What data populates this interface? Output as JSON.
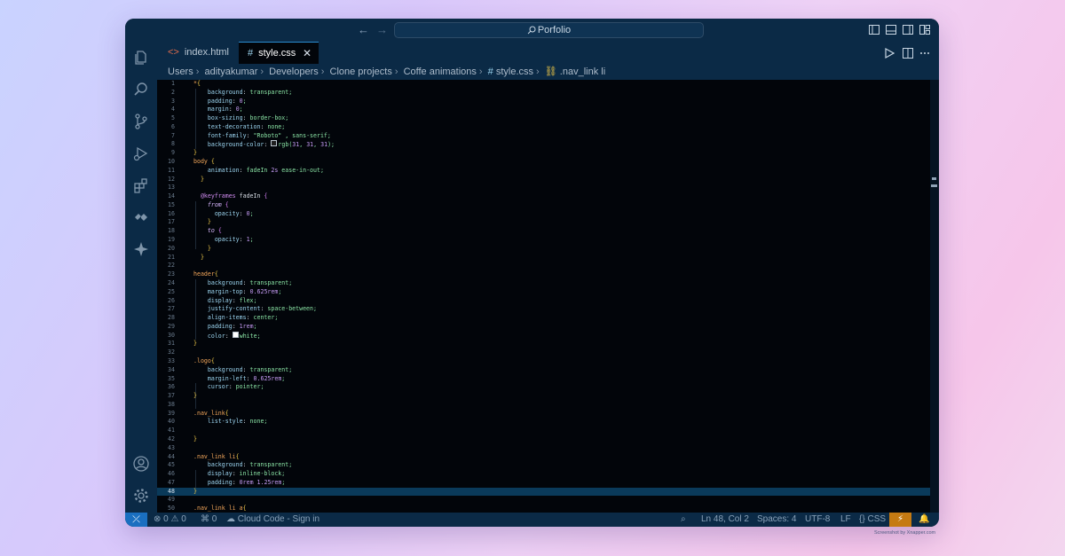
{
  "titlebar": {
    "search_label": "Porfolio"
  },
  "tabs": [
    {
      "label": "index.html",
      "icon": "html-file-icon",
      "active": false
    },
    {
      "label": "style.css",
      "icon": "css-file-icon",
      "active": true,
      "close": "✕"
    }
  ],
  "breadcrumb": [
    "Users",
    "adityakumar",
    "Developers",
    "Clone projects",
    "Coffe animations",
    "style.css",
    ".nav_link li"
  ],
  "editor": {
    "language": "CSS",
    "current_line": 48,
    "lines": [
      {
        "n": "1",
        "t": "*{"
      },
      {
        "n": "2",
        "t": "    background: transparent;"
      },
      {
        "n": "3",
        "t": "    padding: 0;"
      },
      {
        "n": "4",
        "t": "    margin: 0;"
      },
      {
        "n": "5",
        "t": "    box-sizing: border-box;"
      },
      {
        "n": "6",
        "t": "    text-decoration: none;"
      },
      {
        "n": "7",
        "t": "    font-family: \"Roboto\" , sans-serif;"
      },
      {
        "n": "8",
        "t": "    background-color: rgb(31, 31, 31);"
      },
      {
        "n": "9",
        "t": "}"
      },
      {
        "n": "10",
        "t": "body {"
      },
      {
        "n": "11",
        "t": "    animation: fadeIn 2s ease-in-out;"
      },
      {
        "n": "12",
        "t": "  }"
      },
      {
        "n": "13",
        "t": ""
      },
      {
        "n": "14",
        "t": "  @keyframes fadeIn {"
      },
      {
        "n": "15",
        "t": "    from {"
      },
      {
        "n": "16",
        "t": "      opacity: 0;"
      },
      {
        "n": "17",
        "t": "    }"
      },
      {
        "n": "18",
        "t": "    to {"
      },
      {
        "n": "19",
        "t": "      opacity: 1;"
      },
      {
        "n": "20",
        "t": "    }"
      },
      {
        "n": "21",
        "t": "  }"
      },
      {
        "n": "22",
        "t": ""
      },
      {
        "n": "23",
        "t": "header{"
      },
      {
        "n": "24",
        "t": "    background: transparent;"
      },
      {
        "n": "25",
        "t": "    margin-top: 0.625rem;"
      },
      {
        "n": "26",
        "t": "    display: flex;"
      },
      {
        "n": "27",
        "t": "    justify-content: space-between;"
      },
      {
        "n": "28",
        "t": "    align-items: center;"
      },
      {
        "n": "29",
        "t": "    padding: 1rem;"
      },
      {
        "n": "30",
        "t": "    color: white;"
      },
      {
        "n": "31",
        "t": "}"
      },
      {
        "n": "32",
        "t": ""
      },
      {
        "n": "33",
        "t": ".logo{"
      },
      {
        "n": "34",
        "t": "    background: transparent;"
      },
      {
        "n": "35",
        "t": "    margin-left: 0.625rem;"
      },
      {
        "n": "36",
        "t": "    cursor: pointer;"
      },
      {
        "n": "37",
        "t": "}"
      },
      {
        "n": "38",
        "t": ""
      },
      {
        "n": "39",
        "t": ".nav_link{"
      },
      {
        "n": "40",
        "t": "    list-style: none;"
      },
      {
        "n": "41",
        "t": ""
      },
      {
        "n": "42",
        "t": "}"
      },
      {
        "n": "43",
        "t": ""
      },
      {
        "n": "44",
        "t": ".nav_link li{"
      },
      {
        "n": "45",
        "t": "    background: transparent;"
      },
      {
        "n": "46",
        "t": "    display: inline-block;"
      },
      {
        "n": "47",
        "t": "    padding: 0rem 1.25rem;"
      },
      {
        "n": "48",
        "t": "}"
      },
      {
        "n": "49",
        "t": ""
      },
      {
        "n": "50",
        "t": ".nav_link li a{"
      }
    ]
  },
  "statusbar": {
    "errors": "0",
    "warnings": "0",
    "ports": "0",
    "cloud": "Cloud Code - Sign in",
    "position": "Ln 48, Col 2",
    "spaces": "Spaces: 4",
    "encoding": "UTF-8",
    "eol": "LF",
    "language": "CSS"
  },
  "colors": {
    "titlebar": "#0b2a46",
    "editor_bg": "#02050a",
    "accent": "#1a6fc0",
    "selector": "#f2a65a",
    "property": "#9bd4ef",
    "value": "#89e2a4",
    "number": "#c39af2"
  },
  "credit": "Screenshot by Xnapper.com"
}
